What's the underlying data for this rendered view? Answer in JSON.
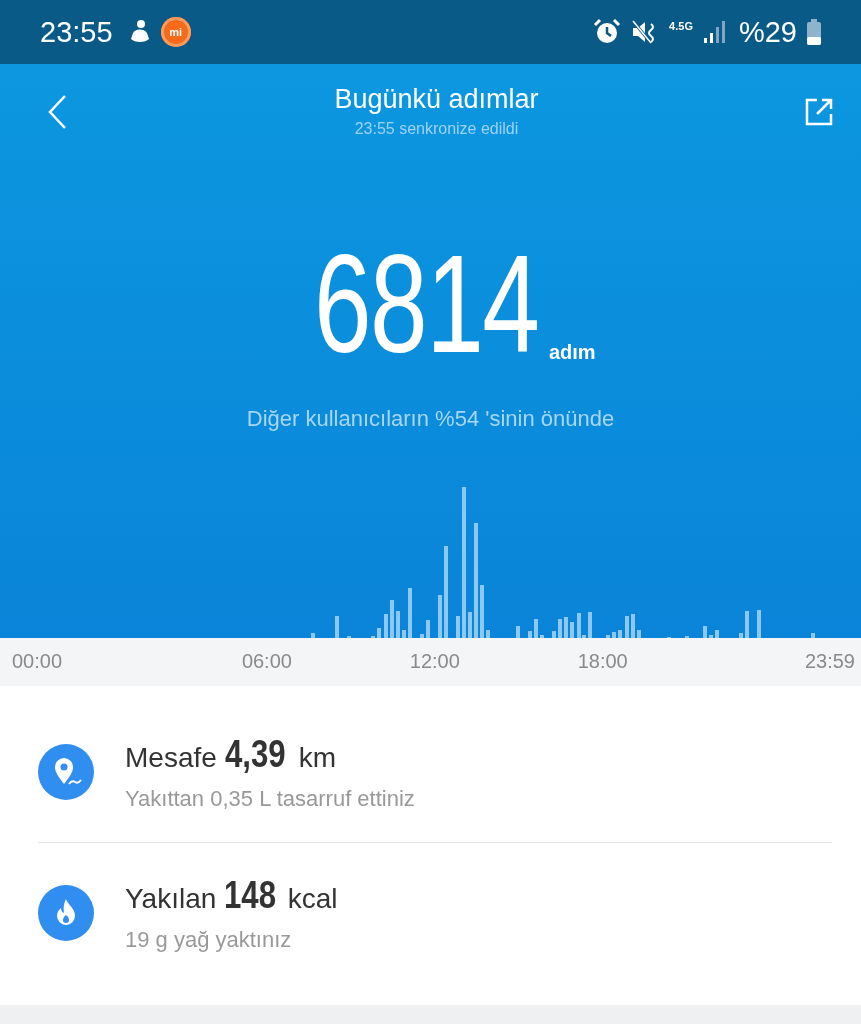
{
  "status_bar": {
    "time": "23:55",
    "app_badge": "mi",
    "network": "4.5G",
    "battery": "%29"
  },
  "header": {
    "title": "Bugünkü adımlar",
    "subtitle": "23:55 senkronize edildi"
  },
  "steps": {
    "count": "6814",
    "unit": "adım",
    "ranking": "Diğer kullanıcıların %54 'sinin önünde"
  },
  "chart": {
    "axis_labels": [
      "00:00",
      "06:00",
      "12:00",
      "18:00",
      "23:59"
    ]
  },
  "stats": [
    {
      "kind": "distance",
      "label": "Mesafe",
      "value": "4,39",
      "unit": "km",
      "detail": "Yakıttan 0,35 L tasarruf ettiniz"
    },
    {
      "kind": "calories",
      "label": "Yakılan",
      "value": "148",
      "unit": "kcal",
      "detail": "19 g yağ yaktınız"
    }
  ]
}
